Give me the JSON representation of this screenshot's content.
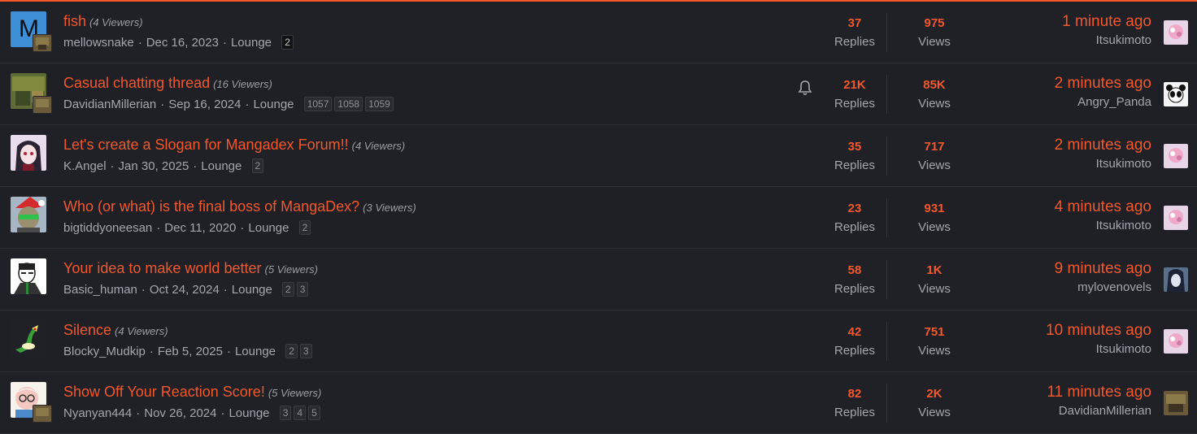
{
  "threads": [
    {
      "title": "fish",
      "viewers": "(4 Viewers)",
      "author": "mellowsnake",
      "date": "Dec 16, 2023",
      "forum": "Lounge",
      "pages": [
        "2"
      ],
      "replies": "37",
      "replies_label": "Replies",
      "views": "975",
      "views_label": "Views",
      "last_time": "1 minute ago",
      "last_user": "Itsukimoto",
      "avatar": "letter-m-avatar",
      "avatar_letter": "M"
    },
    {
      "title": "Casual chatting thread",
      "viewers": "(16 Viewers)",
      "author": "DavidianMillerian",
      "date": "Sep 16, 2024",
      "forum": "Lounge",
      "pages": [
        "1057",
        "1058",
        "1059"
      ],
      "replies": "21K",
      "replies_label": "Replies",
      "views": "85K",
      "views_label": "Views",
      "last_time": "2 minutes ago",
      "last_user": "Angry_Panda",
      "watched": true
    },
    {
      "title": "Let's create a Slogan for Mangadex Forum!!",
      "viewers": "(4 Viewers)",
      "author": "K.Angel",
      "date": "Jan 30, 2025",
      "forum": "Lounge",
      "pages": [
        "2"
      ],
      "replies": "35",
      "replies_label": "Replies",
      "views": "717",
      "views_label": "Views",
      "last_time": "2 minutes ago",
      "last_user": "Itsukimoto"
    },
    {
      "title": "Who (or what) is the final boss of MangaDex?",
      "viewers": "(3 Viewers)",
      "author": "bigtiddyoneesan",
      "date": "Dec 11, 2020",
      "forum": "Lounge",
      "pages": [
        "2"
      ],
      "replies": "23",
      "replies_label": "Replies",
      "views": "931",
      "views_label": "Views",
      "last_time": "4 minutes ago",
      "last_user": "Itsukimoto"
    },
    {
      "title": "Your idea to make world better",
      "viewers": "(5 Viewers)",
      "author": "Basic_human",
      "date": "Oct 24, 2024",
      "forum": "Lounge",
      "pages": [
        "2",
        "3"
      ],
      "replies": "58",
      "replies_label": "Replies",
      "views": "1K",
      "views_label": "Views",
      "last_time": "9 minutes ago",
      "last_user": "mylovenovels"
    },
    {
      "title": "Silence",
      "viewers": "(4 Viewers)",
      "author": "Blocky_Mudkip",
      "date": "Feb 5, 2025",
      "forum": "Lounge",
      "pages": [
        "2",
        "3"
      ],
      "replies": "42",
      "replies_label": "Replies",
      "views": "751",
      "views_label": "Views",
      "last_time": "10 minutes ago",
      "last_user": "Itsukimoto"
    },
    {
      "title": "Show Off Your Reaction Score!",
      "viewers": "(5 Viewers)",
      "author": "Nyanyan444",
      "date": "Nov 26, 2024",
      "forum": "Lounge",
      "pages": [
        "3",
        "4",
        "5"
      ],
      "replies": "82",
      "replies_label": "Replies",
      "views": "2K",
      "views_label": "Views",
      "last_time": "11 minutes ago",
      "last_user": "DavidianMillerian"
    }
  ],
  "colors": {
    "accent": "#f1582d",
    "background": "#1e1f23",
    "text": "#a3a6ad"
  }
}
